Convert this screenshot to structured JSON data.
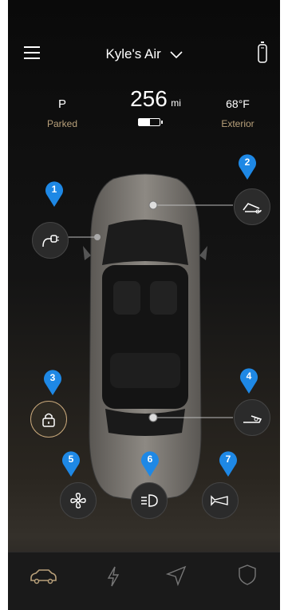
{
  "header": {
    "vehicle_name": "Kyle's Air"
  },
  "status": {
    "gear": "P",
    "gear_label": "Parked",
    "range_value": "256",
    "range_unit": "mi",
    "battery_fraction": 0.55,
    "temperature": "68°F",
    "temperature_label": "Exterior"
  },
  "markers": [
    "1",
    "2",
    "3",
    "4",
    "5",
    "6",
    "7"
  ],
  "controls": [
    {
      "name": "charge-port-button",
      "icon": "charge-port-icon"
    },
    {
      "name": "frunk-button",
      "icon": "frunk-icon"
    },
    {
      "name": "lock-button",
      "icon": "lock-icon"
    },
    {
      "name": "trunk-button",
      "icon": "trunk-icon"
    },
    {
      "name": "climate-button",
      "icon": "fan-icon"
    },
    {
      "name": "headlights-button",
      "icon": "headlight-icon"
    },
    {
      "name": "horn-button",
      "icon": "horn-icon"
    }
  ],
  "tabs": [
    "car-icon",
    "bolt-icon",
    "navigation-icon",
    "shield-icon"
  ],
  "colors": {
    "accent_gold": "#c7a77a",
    "marker_blue": "#1e88e5",
    "annotation_arrow": "#3a6ad6"
  }
}
